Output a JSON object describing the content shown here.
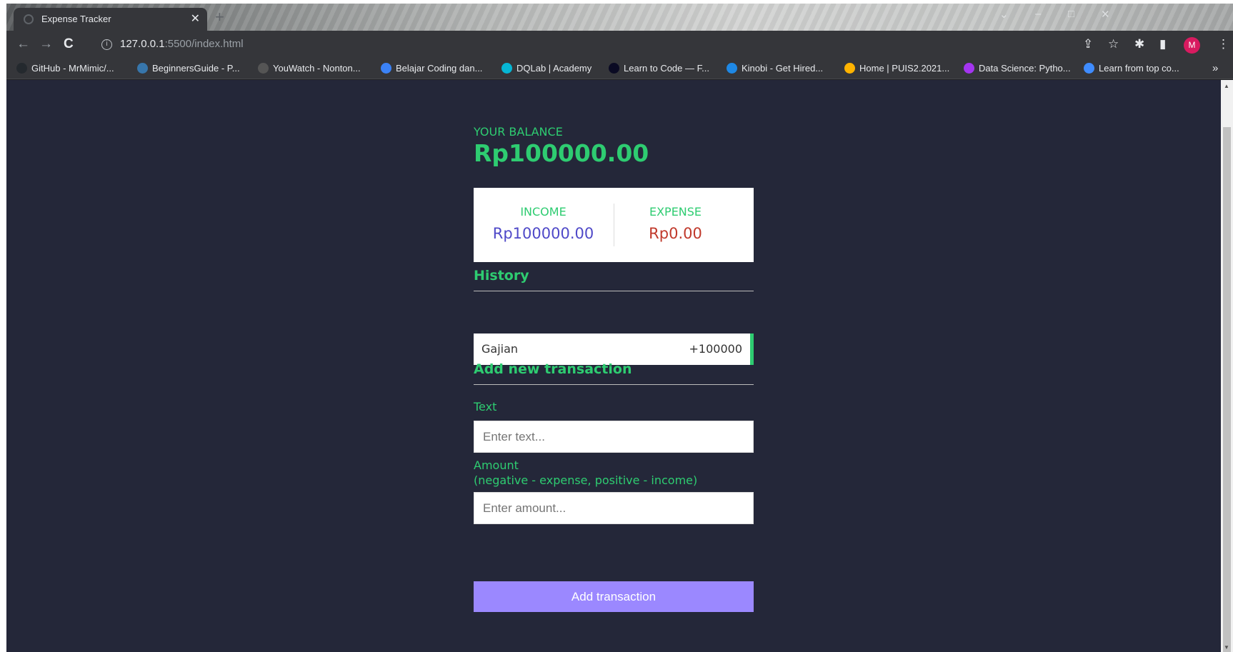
{
  "browser": {
    "tab_title": "Expense Tracker",
    "tab_close": "✕",
    "new_tab": "+",
    "url_host": "127.0.0.1",
    "url_path": ":5500/index.html",
    "avatar_letter": "M"
  },
  "bookmarks": [
    {
      "label": "GitHub - MrMimic/...",
      "icon": "github-icon",
      "color": "#24292e"
    },
    {
      "label": "BeginnersGuide - P...",
      "icon": "python-icon",
      "color": "#3776ab"
    },
    {
      "label": "YouWatch - Nonton...",
      "icon": "youwatch-icon",
      "color": "#555555"
    },
    {
      "label": "Belajar Coding dan...",
      "icon": "dicoding-icon",
      "color": "#3b82f6"
    },
    {
      "label": "DQLab | Academy",
      "icon": "dqlab-icon",
      "color": "#06b6d4"
    },
    {
      "label": "Learn to Code — F...",
      "icon": "freecodecamp-icon",
      "color": "#0a0a23"
    },
    {
      "label": "Kinobi - Get Hired...",
      "icon": "kinobi-icon",
      "color": "#1e88e5"
    },
    {
      "label": "Home | PUIS2.2021...",
      "icon": "puis-icon",
      "color": "#ffb300"
    },
    {
      "label": "Data Science: Pytho...",
      "icon": "udemy-icon",
      "color": "#a435f0"
    },
    {
      "label": "Learn from top co...",
      "icon": "gem-icon",
      "color": "#3f8cff"
    }
  ],
  "bookmarks_more": "»",
  "app": {
    "balance_label": "YOUR BALANCE",
    "balance_value": "Rp100000.00",
    "income_label": "INCOME",
    "income_value": "Rp100000.00",
    "expense_label": "EXPENSE",
    "expense_value": "Rp0.00",
    "history_title": "History",
    "history": [
      {
        "text": "Gajian",
        "amount": "+100000"
      }
    ],
    "add_title": "Add new transaction",
    "text_label": "Text",
    "text_placeholder": "Enter text...",
    "amount_label_line1": "Amount",
    "amount_label_line2": "(negative - expense, positive - income)",
    "amount_placeholder": "Enter amount...",
    "add_button": "Add transaction"
  },
  "colors": {
    "accent_green": "#2ecc71",
    "income": "#4f49c8",
    "expense": "#c0392b",
    "button": "#9b88ff",
    "background": "#242739"
  }
}
